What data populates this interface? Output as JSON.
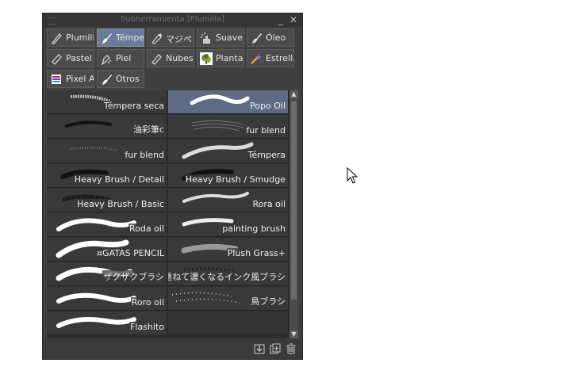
{
  "window": {
    "title": "Subherramienta [Plumilla]",
    "minimize": "_",
    "close": "✕"
  },
  "tabs": [
    {
      "label": "Plumilla",
      "icon": "pen-icon",
      "selected": false
    },
    {
      "label": "Témpera",
      "icon": "paint-brush-icon",
      "selected": true
    },
    {
      "label": "マジペン",
      "icon": "marker-icon",
      "selected": false
    },
    {
      "label": "Suave",
      "icon": "airbrush-icon",
      "selected": false
    },
    {
      "label": "Óleo",
      "icon": "oil-brush-icon",
      "selected": false
    },
    {
      "label": "Pastel",
      "icon": "pastel-icon",
      "selected": false
    },
    {
      "label": "Piel",
      "icon": "skin-brush-icon",
      "selected": false
    },
    {
      "label": "Nubes",
      "icon": "cloud-brush-icon",
      "selected": false
    },
    {
      "label": "Plantas",
      "icon": "plant-icon",
      "selected": false
    },
    {
      "label": "Estrellas",
      "icon": "star-brush-icon",
      "selected": false
    },
    {
      "label": "Pixel Art",
      "icon": "pixel-art-icon",
      "selected": false
    },
    {
      "label": "Otros",
      "icon": "brush-other-icon",
      "selected": false
    }
  ],
  "brushes": [
    {
      "name": "Témpera seca",
      "selected": false
    },
    {
      "name": "Popo Oil",
      "selected": true
    },
    {
      "name": "油彩筆c",
      "selected": false
    },
    {
      "name": "fur blend",
      "selected": false
    },
    {
      "name": "fur blend",
      "selected": false
    },
    {
      "name": "Témpera",
      "selected": false
    },
    {
      "name": "Heavy Brush / Detail",
      "selected": false
    },
    {
      "name": "Heavy Brush / Smudge",
      "selected": false
    },
    {
      "name": "Heavy Brush / Basic",
      "selected": false
    },
    {
      "name": "Rora oil",
      "selected": false
    },
    {
      "name": "Roda oil",
      "selected": false
    },
    {
      "name": "painting brush",
      "selected": false
    },
    {
      "name": "¤GATAS PENCIL",
      "selected": false
    },
    {
      "name": "Plush Grass+",
      "selected": false
    },
    {
      "name": "ザクザクブラシ",
      "selected": false
    },
    {
      "name": "重ねて濃くなるインク風ブラシ",
      "selected": false
    },
    {
      "name": "Roro oil",
      "selected": false
    },
    {
      "name": "鳥ブラシ",
      "selected": false
    },
    {
      "name": "Flashito",
      "selected": false
    }
  ],
  "footer": {
    "icons": [
      "import-icon",
      "duplicate-icon",
      "trash-icon"
    ]
  },
  "colors": {
    "panel_bg": "#3f3f3f",
    "selected_bg": "#5f6b85",
    "text": "#efefef"
  }
}
